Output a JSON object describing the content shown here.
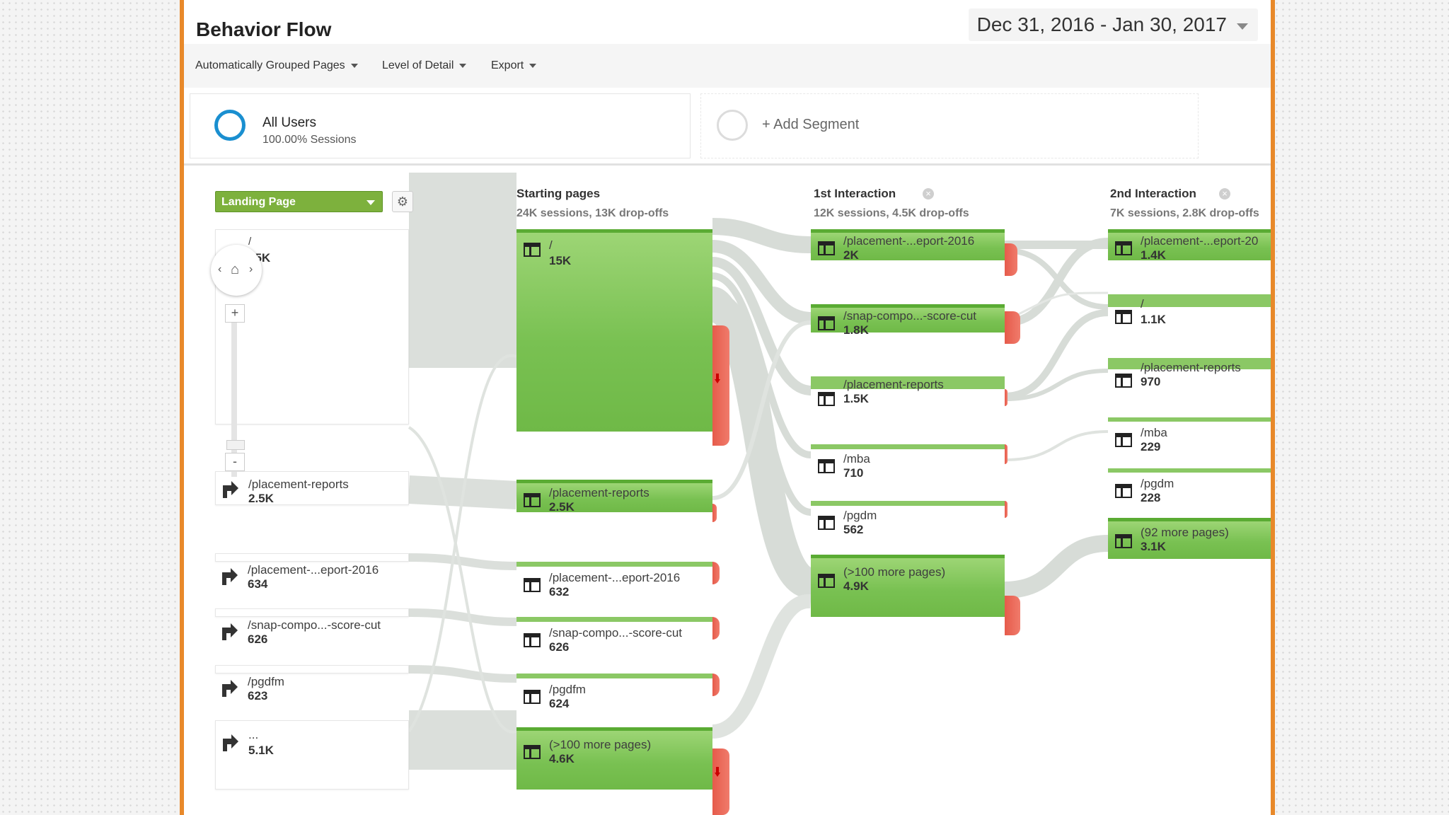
{
  "header": {
    "title": "Behavior Flow",
    "date_range": "Dec 31, 2016 - Jan 30, 2017"
  },
  "toolbar": {
    "grouped_pages": "Automatically Grouped Pages",
    "level_of_detail": "Level of Detail",
    "export": "Export"
  },
  "segments": {
    "all_users_name": "All Users",
    "all_users_sub": "100.00% Sessions",
    "add_segment": "+ Add Segment"
  },
  "dimension_select": "Landing Page",
  "navigator": {
    "left": "‹",
    "home": "⌂",
    "right": "›",
    "zoom_in": "+",
    "zoom_out": "-"
  },
  "columns": {
    "starting": {
      "title": "Starting pages",
      "sub": "24K sessions, 13K drop-offs"
    },
    "first": {
      "title": "1st Interaction",
      "sub": "12K sessions, 4.5K drop-offs"
    },
    "second": {
      "title": "2nd Interaction",
      "sub": "7K sessions, 2.8K drop-offs"
    }
  },
  "landing_pages": [
    {
      "label": "/",
      "value": "15K"
    },
    {
      "label": "/placement-reports",
      "value": "2.5K"
    },
    {
      "label": "/placement-...eport-2016",
      "value": "634"
    },
    {
      "label": "/snap-compo...-score-cut",
      "value": "626"
    },
    {
      "label": "/pgdfm",
      "value": "623"
    },
    {
      "label": "...",
      "value": "5.1K"
    }
  ],
  "starting_pages": [
    {
      "label": "/",
      "value": "15K"
    },
    {
      "label": "/placement-reports",
      "value": "2.5K"
    },
    {
      "label": "/placement-...eport-2016",
      "value": "632"
    },
    {
      "label": "/snap-compo...-score-cut",
      "value": "626"
    },
    {
      "label": "/pgdfm",
      "value": "624"
    },
    {
      "label": "(>100 more pages)",
      "value": "4.6K"
    }
  ],
  "first_interaction": [
    {
      "label": "/placement-...eport-2016",
      "value": "2K"
    },
    {
      "label": "/snap-compo...-score-cut",
      "value": "1.8K"
    },
    {
      "label": "/placement-reports",
      "value": "1.5K"
    },
    {
      "label": "/mba",
      "value": "710"
    },
    {
      "label": "/pgdm",
      "value": "562"
    },
    {
      "label": "(>100 more pages)",
      "value": "4.9K"
    }
  ],
  "second_interaction": [
    {
      "label": "/placement-...eport-20",
      "value": "1.4K"
    },
    {
      "label": "/",
      "value": "1.1K"
    },
    {
      "label": "/placement-reports",
      "value": "970"
    },
    {
      "label": "/mba",
      "value": "229"
    },
    {
      "label": "/pgdm",
      "value": "228"
    },
    {
      "label": "(92 more pages)",
      "value": "3.1K"
    }
  ],
  "colors": {
    "frame_border": "#e8892a",
    "node_green": "#79c152",
    "dropoff_red": "#e65b4b",
    "segment_ring": "#1a8fd0"
  }
}
